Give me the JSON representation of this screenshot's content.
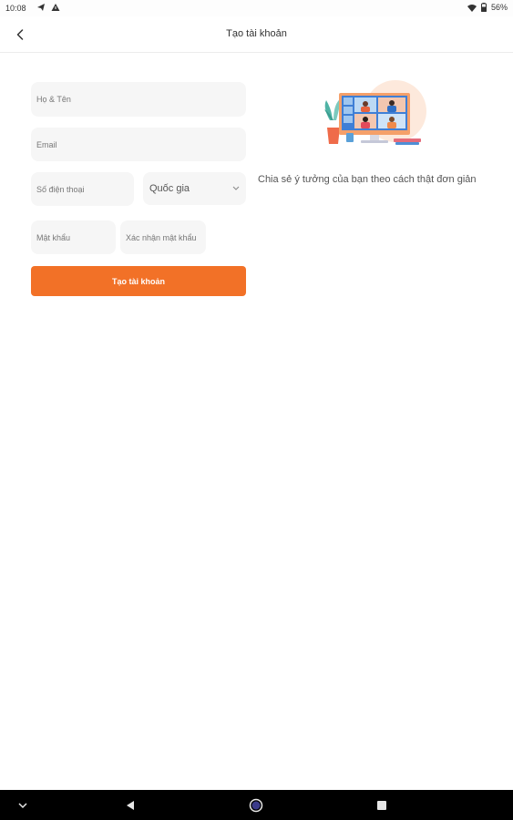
{
  "status_bar": {
    "time": "10:08",
    "battery": "56%"
  },
  "app_bar": {
    "title": "Tạo tài khoản"
  },
  "form": {
    "full_name_placeholder": "Họ & Tên",
    "email_placeholder": "Email",
    "phone_placeholder": "Số điện thoại",
    "country_label": "Quốc gia",
    "password_placeholder": "Mật khẩu",
    "confirm_password_placeholder": "Xác nhận mật khẩu",
    "submit_label": "Tạo tài khoản"
  },
  "promo": {
    "tagline": "Chia sẻ ý tưởng của bạn theo cách thật đơn giản"
  },
  "colors": {
    "accent": "#f27127",
    "field_background": "#f6f6f6"
  },
  "icons": {
    "back": "chevron-left-icon",
    "select": "chevron-down-icon",
    "wifi": "wifi-icon",
    "battery": "battery-icon",
    "nav_down": "chevron-down-icon",
    "nav_back": "triangle-back-icon",
    "nav_home": "circle-home-icon",
    "nav_recents": "square-recents-icon"
  }
}
